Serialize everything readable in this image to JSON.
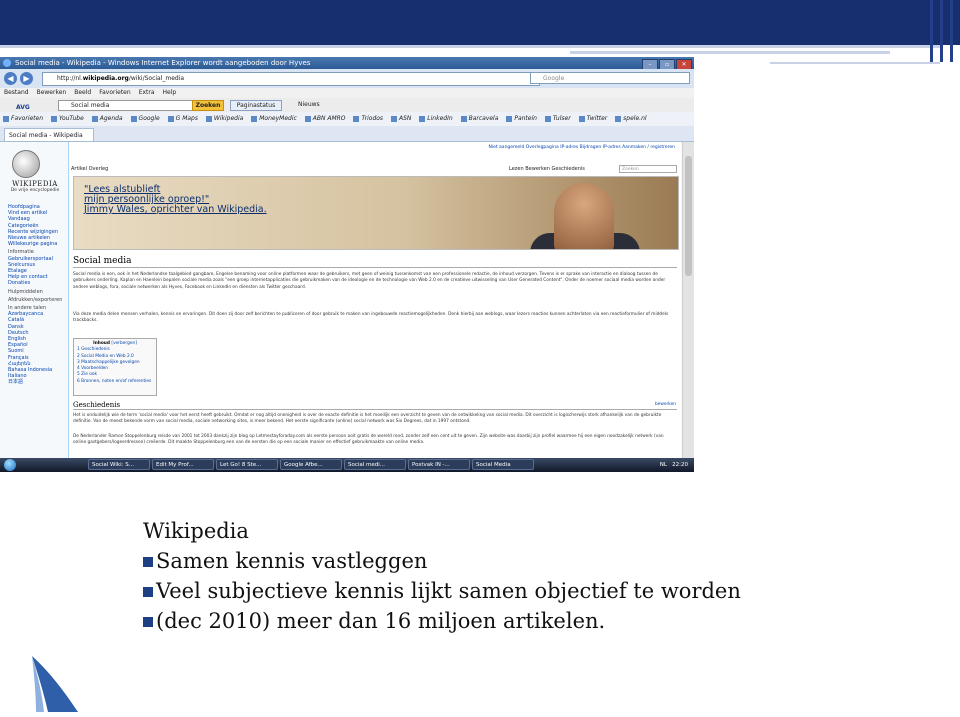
{
  "screenshot": {
    "window_title": "Social media - Wikipedia - Windows Internet Explorer wordt aangeboden door Hyves",
    "address": {
      "prefix": "http://nl.",
      "domain": "wikipedia.org",
      "path": "/wiki/Social_media"
    },
    "search_placeholder": "Google",
    "menu": [
      "Bestand",
      "Bewerken",
      "Beeld",
      "Favorieten",
      "Extra",
      "Help"
    ],
    "avg_toolbar": {
      "logo": "AVG",
      "query": "Social media",
      "search_button": "Zoeken",
      "status_button": "Paginastatus",
      "news": "Nieuws"
    },
    "favorites": [
      "Favorieten",
      "YouTube",
      "Agenda",
      "Google",
      "G Maps",
      "Wikipedia",
      "MoneyMedic",
      "ABN AMRO",
      "Triodos",
      "ASN",
      "LinkedIn",
      "Barcavela",
      "Panteín",
      "Tulser",
      "Twitter",
      "spele.nl"
    ],
    "tab_label": "Social media - Wikipedia",
    "wiki": {
      "wordmark": "WIKIPEDIA",
      "tagline": "De vrije encyclopedie",
      "sidebar": [
        "Hoofdpagina",
        "Vind een artikel",
        "Vandaag",
        "Categorieën",
        "Recente wijzigingen",
        "Nieuwe artikelen",
        "Willekeurige pagina"
      ],
      "sidebar_section_info": "Informatie",
      "sidebar_info": [
        "Gebruikersportaal",
        "Snelcursus",
        "Etalage",
        "Help en contact",
        "Donaties"
      ],
      "sidebar_tools": "Hulpmiddelen",
      "sidebar_print": "Afdrukken/exporteren",
      "sidebar_langs_head": "In andere talen",
      "sidebar_langs": [
        "Azərbaycanca",
        "Català",
        "Dansk",
        "Deutsch",
        "English",
        "Español",
        "Suomi",
        "Français",
        "Հայերեն",
        "Bahasa Indonesia",
        "Italiano",
        "日本語"
      ],
      "user_links": "Niet aangemeld  Overlegpagina IP-adres  Bijdragen IP-adres  Aanmaken / registreren",
      "page_tabs_left": "Artikel   Overleg",
      "page_tabs_right": "Lezen   Bewerken   Geschiedenis",
      "search_placeholder": "Zoeken",
      "banner_line1": "\"Lees alstublieft",
      "banner_line2": "mijn persoonlijke oproep!\"",
      "banner_line3": "Jimmy Wales, oprichter van Wikipedia.",
      "title": "Social media",
      "para1": "Social media is een, ook in het Nederlandse taalgebied gangbare, Engelse benaming voor online platformen waar de gebruikers, met geen of weinig tussenkomst van een professionele redactie, de inhoud verzorgen. Tevens is er sprake van interactie en dialoog tussen de gebruikers onderling. Kaplan en Haenlein bepalen sociale media zoals \"een groep internetapplicaties die gebruikmaken van de ideologie en de technologie van Web 2.0 en de creatieve uitwisseling van User Generated Content\". Onder de noemer sociaal media worden onder andere weblogs, fora, sociale netwerken als Hyves, Facebook en LinkedIn en diensten als Twitter geschaard.",
      "para2": "Via deze media delen mensen verhalen, kennis en ervaringen. Dit doen zij door zelf berichten te publiceren of door gebruik te maken van ingebouwde reactiemogelijkheden. Denk hierbij aan weblogs, waar lezers reacties kunnen achterlaten via een reactieformulier of middels trackbacks.",
      "toc_title": "Inhoud",
      "toc_toggle": "[verbergen]",
      "toc": [
        "1 Geschiedenis",
        "2 Social Media en Web 2.0",
        "3 Maatschappelijke gevolgen",
        "4 Voorbeelden",
        "5 Zie ook",
        "6 Bronnen, noten en/of referenties"
      ],
      "section": "Geschiedenis",
      "section_edit": "bewerken",
      "para3": "Het is onduidelijk wie de term 'social media' voor het eerst heeft gebruikt. Omdat er nog altijd onenigheid is over de exacte definitie is het moeilijk een overzicht te geven van de ontwikkeling van social media. Dit overzicht is logischerwijs sterk afhankelijk van de gebruikte definitie. Van de meest bekende vorm van social media, sociale networking sites, is meer bekend. Het eerste significante (online) social network was Six Degrees, dat in 1997 ontstond.",
      "para4": "De Nederlander Ramon Stoppelenburg reisde van 2001 tot 2003 dankzij zijn blog op Letmestayforaday.com als eerste persoon ooit gratis de wereld rond, zonder zelf een cent uit te geven. Zijn website was daarbij zijn profiel waarmee hij een eigen noodzakelijk netwerk (van online gastgebers/logeerdressen) creëerde. Dit maakte Stoppelenburg een van de eersten die op een sociale manier en effectief gebruikmaakte van online media."
    },
    "taskbar": {
      "items": [
        "Social Wiki: S...",
        "Edit My Prof...",
        "Let Go! 8 Ste...",
        "Google Afbe...",
        "Social medi...",
        "Postvak IN -...",
        "Social Media"
      ],
      "lang": "NL",
      "clock": "22:20"
    }
  },
  "slide": {
    "heading": "Wikipedia",
    "bullets": [
      "Samen kennis vastleggen",
      "Veel subjectieve kennis lijkt samen objectief te worden",
      "(dec 2010)  meer dan 16 miljoen artikelen."
    ]
  },
  "colors": {
    "header": "#172f6e",
    "bullet": "#1f3f85",
    "sail": "#2f5fa8"
  }
}
